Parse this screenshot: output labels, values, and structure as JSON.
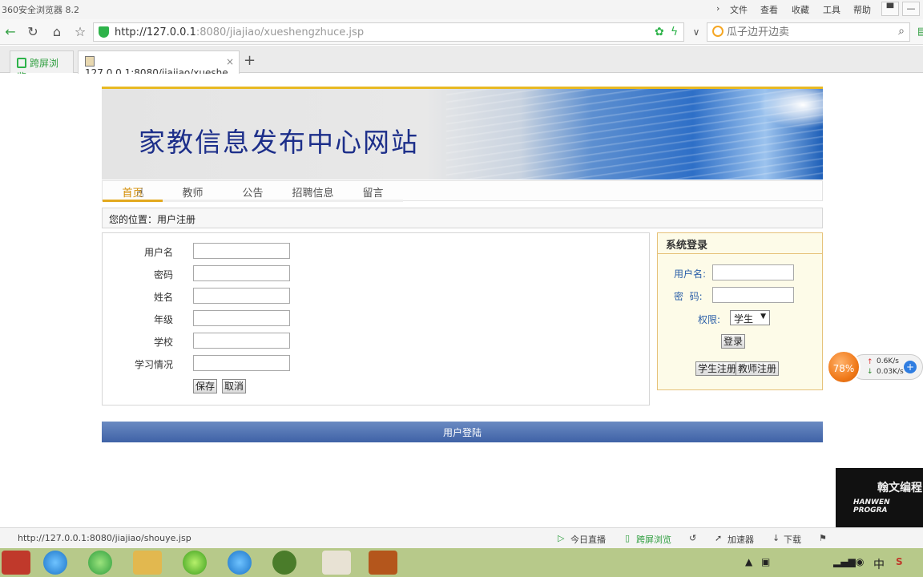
{
  "browser": {
    "app_title": "360安全浏览器 8.2",
    "menu": [
      "文件",
      "查看",
      "收藏",
      "工具",
      "帮助"
    ],
    "url_host": "http://127.0.0.1",
    "url_rest": ":8080/jiajiao/xueshengzhuce.jsp",
    "search_placeholder": "瓜子边开边卖",
    "tabs": [
      {
        "label": "跨屏浏览"
      },
      {
        "label": "127.0.0.1:8080/jiajiao/xueshe"
      }
    ]
  },
  "site": {
    "title": "家教信息发布中心网站",
    "nav": [
      "首页",
      "教师",
      "公告",
      "招聘信息",
      "留言"
    ],
    "breadcrumb": "您的位置：用户注册"
  },
  "register_form": {
    "fields": [
      {
        "label": "用户名"
      },
      {
        "label": "密码"
      },
      {
        "label": "姓名"
      },
      {
        "label": "年级"
      },
      {
        "label": "学校"
      },
      {
        "label": "学习情况"
      }
    ],
    "save_label": "保存",
    "cancel_label": "取消"
  },
  "login_box": {
    "title": "系统登录",
    "username_label": "用户名:",
    "password_label": "密  码:",
    "role_label": "权限:",
    "role_value": "学生",
    "login_label": "登录",
    "student_register": "学生注册",
    "teacher_register": "教师注册"
  },
  "footer_text": "用户登陆",
  "net_widget": {
    "percent": "78%",
    "up": "0.6K/s",
    "down": "0.03K/s"
  },
  "overlay_logo": {
    "cn": "翰文编程",
    "en": "HANWEN PROGRA"
  },
  "status": {
    "url": "http://127.0.0.1:8080/jiajiao/shouye.jsp",
    "items": [
      "今日直播",
      "跨屏浏览",
      "加速器",
      "下载"
    ]
  },
  "taskbar": {
    "ime": "中"
  }
}
